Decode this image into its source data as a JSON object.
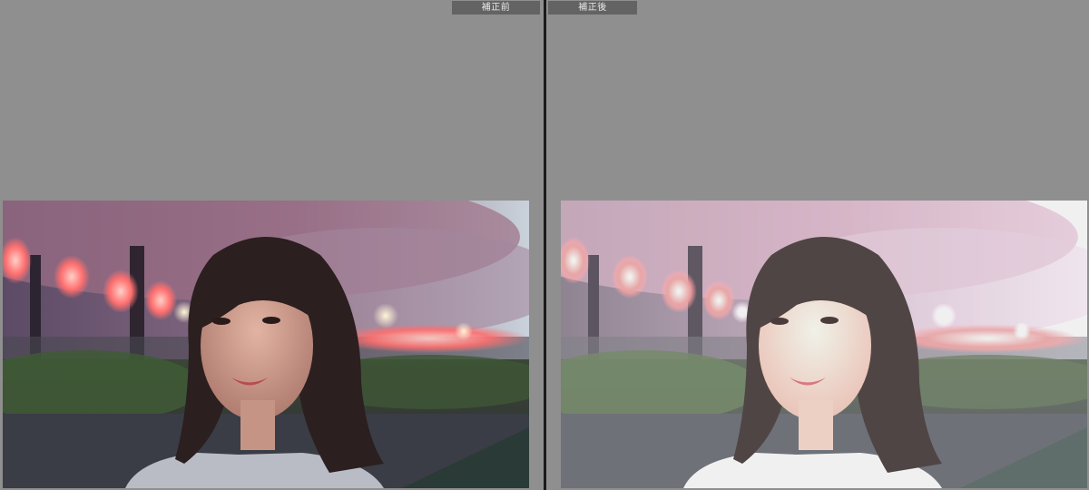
{
  "left_pane": {
    "label": "補正前",
    "image": "portrait-before"
  },
  "right_pane": {
    "label": "補正後",
    "image": "portrait-after"
  },
  "colors": {
    "background": "#8f8f8f",
    "divider": "#1a1a1a",
    "label_bg": "#636363",
    "label_text": "#e9e9e9"
  }
}
